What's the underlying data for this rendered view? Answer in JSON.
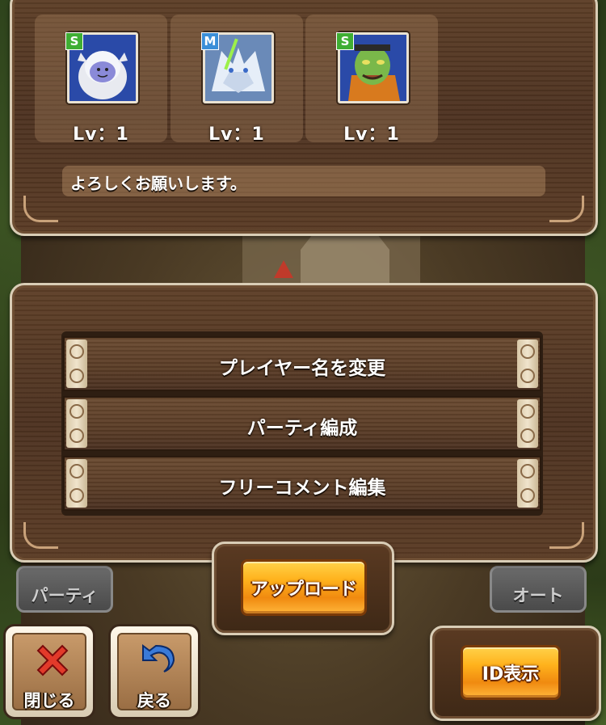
{
  "profile": {
    "monsters": [
      {
        "rank": "S",
        "level_text": "Lv：1",
        "icon": "white-yeti-monster-icon"
      },
      {
        "rank": "M",
        "level_text": "Lv：1",
        "icon": "white-wolf-monster-icon"
      },
      {
        "rank": "S",
        "level_text": "Lv：1",
        "icon": "green-orc-monster-icon"
      }
    ],
    "comment": "よろしくお願いします。"
  },
  "menu": {
    "items": [
      {
        "label": "プレイヤー名を変更"
      },
      {
        "label": "パーティ編成"
      },
      {
        "label": "フリーコメント編集"
      }
    ]
  },
  "background": {
    "left_button": "パーティ",
    "right_button": "オート"
  },
  "actions": {
    "upload_label": "アップロード",
    "id_label": "ID表示",
    "close_label": "閉じる",
    "back_label": "戻る"
  },
  "colors": {
    "rank_s": "#3fae33",
    "rank_m": "#3b8fd8",
    "gold_button": "#ffb21c",
    "frame_cream": "#d9cdb6",
    "close_red": "#e23a2a",
    "back_blue": "#3a7ad8"
  }
}
